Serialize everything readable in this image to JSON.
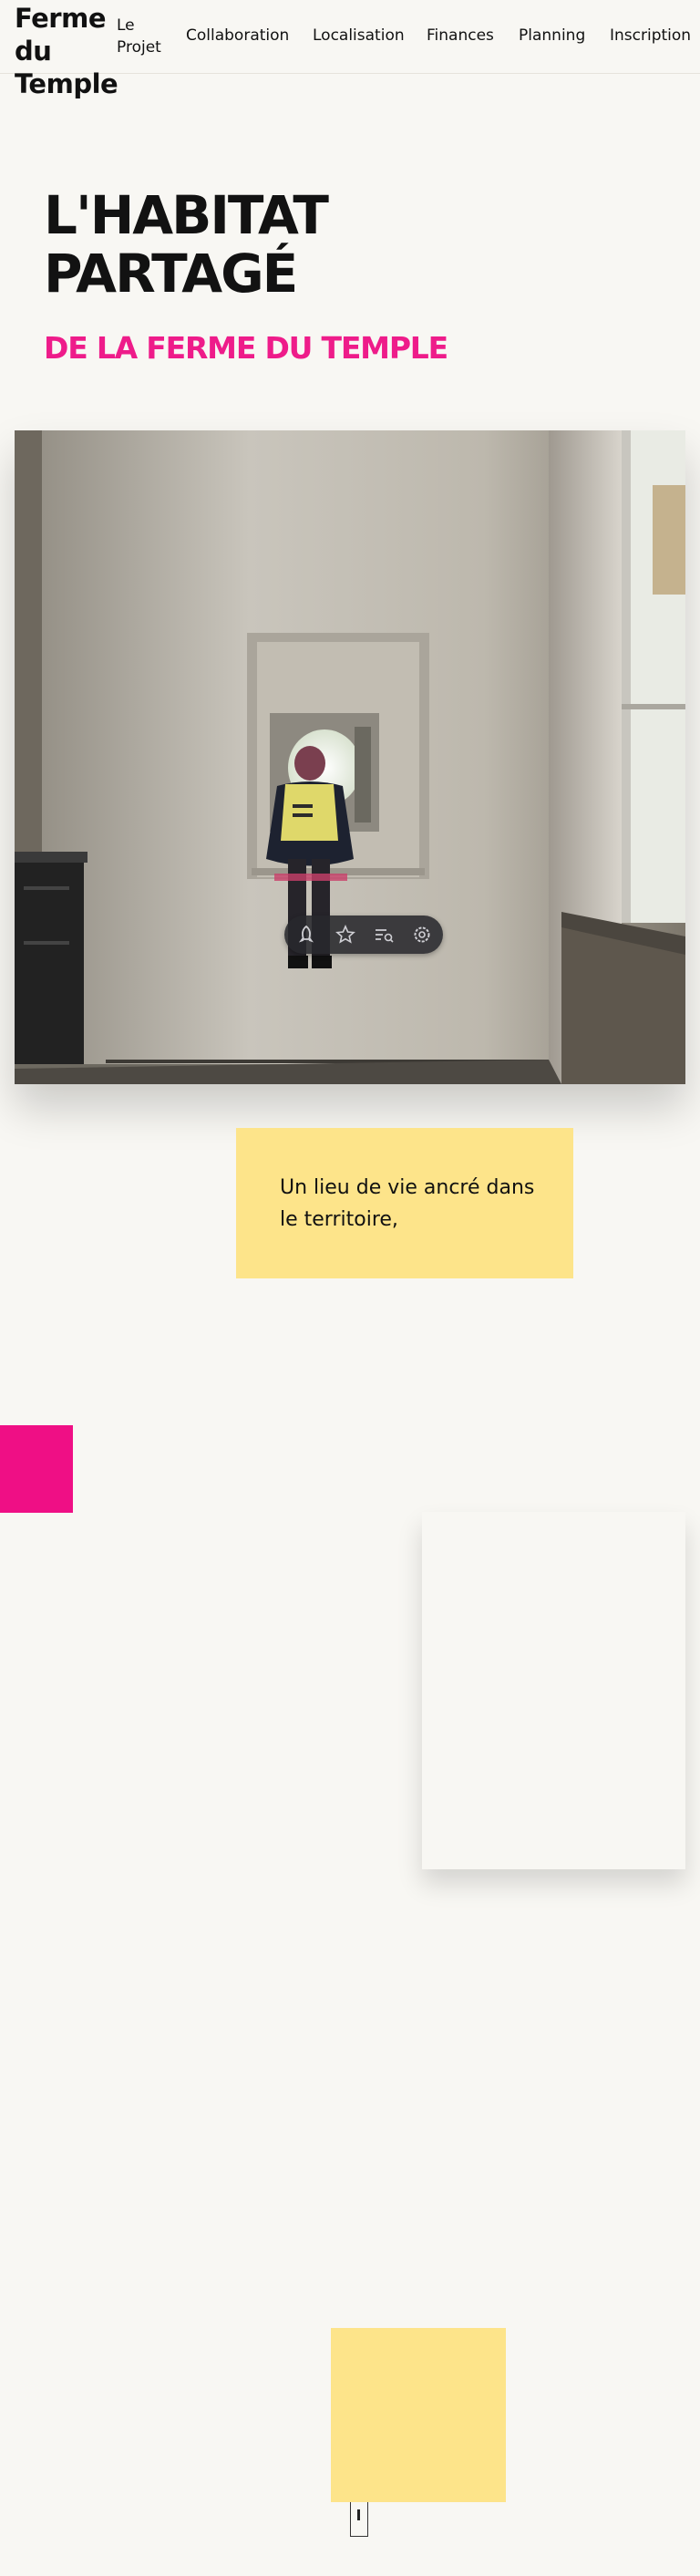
{
  "header": {
    "site_title": "Ferme du Temple",
    "nav": [
      "Le Projet",
      "Collaboration",
      "Localisation",
      "Finances",
      "Planning",
      "Inscription"
    ]
  },
  "hero": {
    "title": "L'HABITAT PARTAGÉ",
    "subtitle": "DE LA FERME DU TEMPLE"
  },
  "photo_toolbar": {
    "icons": [
      "rocket-icon",
      "star-icon",
      "search-list-icon",
      "settings-icon"
    ]
  },
  "callout": {
    "text": "Un lieu de vie ancré dans le territoire,"
  },
  "colors": {
    "background": "#f8f7f3",
    "accent_pink": "#ee1c8a",
    "accent_yellow": "#fde48a",
    "text": "#111111"
  }
}
